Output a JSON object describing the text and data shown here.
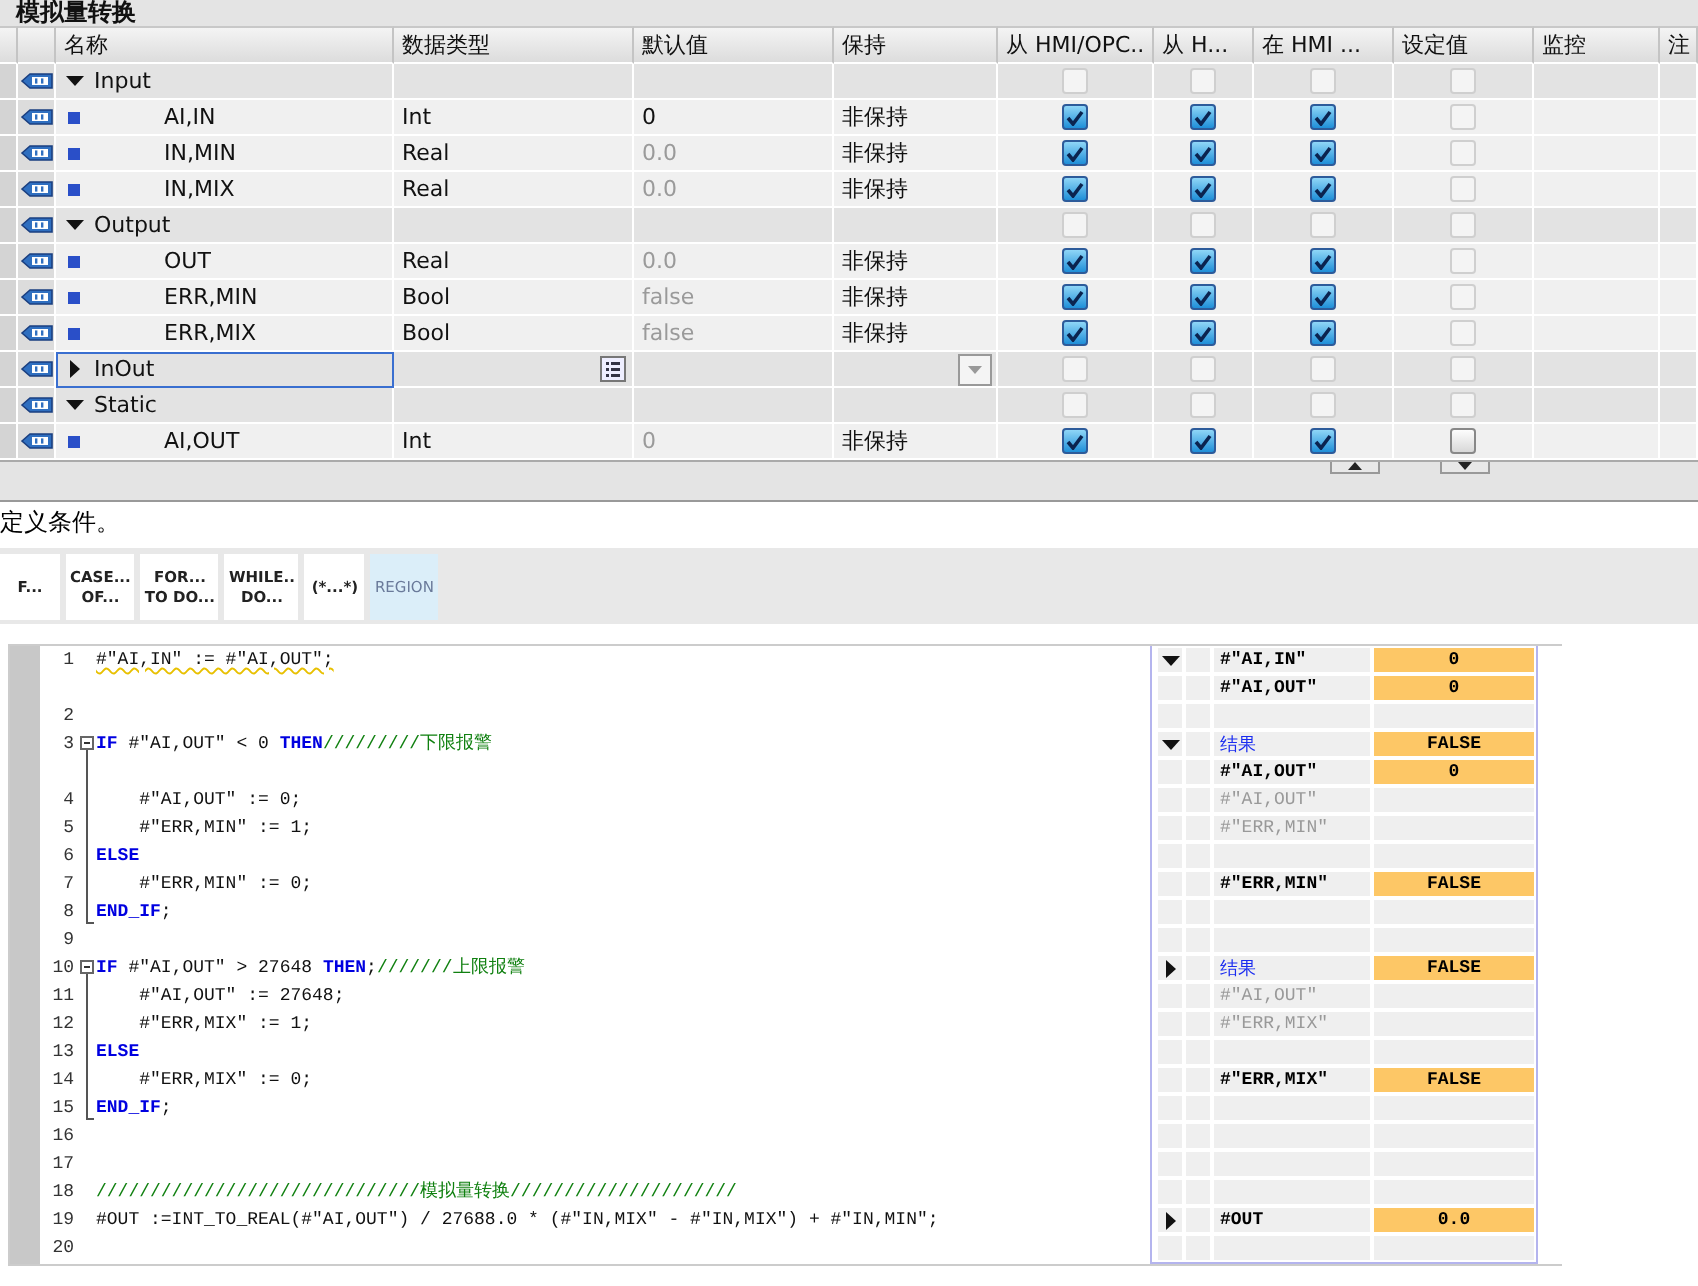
{
  "block_title": "模拟量转换",
  "table": {
    "columns": [
      "名称",
      "数据类型",
      "默认值",
      "保持",
      "从 HMI/OPC..",
      "从 H...",
      "在 HMI ...",
      "设定值",
      "监控",
      "注"
    ],
    "rows": [
      {
        "kind": "section",
        "name": "Input",
        "expanded": true,
        "selected": false,
        "checkboxes": [
          {
            "checked": false,
            "disabled": true
          },
          {
            "checked": false,
            "disabled": true
          },
          {
            "checked": false,
            "disabled": true
          },
          {
            "checked": false,
            "disabled": true
          }
        ]
      },
      {
        "kind": "var",
        "name": "AI,IN",
        "type": "Int",
        "default": "0",
        "default_dim": false,
        "retain": "非保持",
        "selected": false,
        "checkboxes": [
          {
            "checked": true,
            "disabled": false
          },
          {
            "checked": true,
            "disabled": false
          },
          {
            "checked": true,
            "disabled": false
          },
          {
            "checked": false,
            "disabled": true
          }
        ]
      },
      {
        "kind": "var",
        "name": "IN,MIN",
        "type": "Real",
        "default": "0.0",
        "default_dim": true,
        "retain": "非保持",
        "selected": false,
        "checkboxes": [
          {
            "checked": true,
            "disabled": false
          },
          {
            "checked": true,
            "disabled": false
          },
          {
            "checked": true,
            "disabled": false
          },
          {
            "checked": false,
            "disabled": true
          }
        ]
      },
      {
        "kind": "var",
        "name": "IN,MIX",
        "type": "Real",
        "default": "0.0",
        "default_dim": true,
        "retain": "非保持",
        "selected": false,
        "checkboxes": [
          {
            "checked": true,
            "disabled": false
          },
          {
            "checked": true,
            "disabled": false
          },
          {
            "checked": true,
            "disabled": false
          },
          {
            "checked": false,
            "disabled": true
          }
        ]
      },
      {
        "kind": "section",
        "name": "Output",
        "expanded": true,
        "selected": false,
        "checkboxes": [
          {
            "checked": false,
            "disabled": true
          },
          {
            "checked": false,
            "disabled": true
          },
          {
            "checked": false,
            "disabled": true
          },
          {
            "checked": false,
            "disabled": true
          }
        ]
      },
      {
        "kind": "var",
        "name": "OUT",
        "type": "Real",
        "default": "0.0",
        "default_dim": true,
        "retain": "非保持",
        "selected": false,
        "checkboxes": [
          {
            "checked": true,
            "disabled": false
          },
          {
            "checked": true,
            "disabled": false
          },
          {
            "checked": true,
            "disabled": false
          },
          {
            "checked": false,
            "disabled": true
          }
        ]
      },
      {
        "kind": "var",
        "name": "ERR,MIN",
        "type": "Bool",
        "default": "false",
        "default_dim": true,
        "retain": "非保持",
        "selected": false,
        "checkboxes": [
          {
            "checked": true,
            "disabled": false
          },
          {
            "checked": true,
            "disabled": false
          },
          {
            "checked": true,
            "disabled": false
          },
          {
            "checked": false,
            "disabled": true
          }
        ]
      },
      {
        "kind": "var",
        "name": "ERR,MIX",
        "type": "Bool",
        "default": "false",
        "default_dim": true,
        "retain": "非保持",
        "selected": false,
        "checkboxes": [
          {
            "checked": true,
            "disabled": false
          },
          {
            "checked": true,
            "disabled": false
          },
          {
            "checked": true,
            "disabled": false
          },
          {
            "checked": false,
            "disabled": true
          }
        ]
      },
      {
        "kind": "section",
        "name": "InOut",
        "expanded": false,
        "selected": true,
        "checkboxes": [
          {
            "checked": false,
            "disabled": true
          },
          {
            "checked": false,
            "disabled": true
          },
          {
            "checked": false,
            "disabled": true
          },
          {
            "checked": false,
            "disabled": true
          }
        ]
      },
      {
        "kind": "section",
        "name": "Static",
        "expanded": true,
        "selected": false,
        "checkboxes": [
          {
            "checked": false,
            "disabled": true
          },
          {
            "checked": false,
            "disabled": true
          },
          {
            "checked": false,
            "disabled": true
          },
          {
            "checked": false,
            "disabled": true
          }
        ]
      },
      {
        "kind": "var",
        "name": "AI,OUT",
        "type": "Int",
        "default": "0",
        "default_dim": true,
        "retain": "非保持",
        "selected": false,
        "checkboxes": [
          {
            "checked": true,
            "disabled": false
          },
          {
            "checked": true,
            "disabled": false
          },
          {
            "checked": true,
            "disabled": false
          },
          {
            "checked": false,
            "disabled": false
          }
        ]
      }
    ]
  },
  "description": "定义条件。",
  "toolbar": [
    {
      "label": "F...",
      "selected": false
    },
    {
      "label": "CASE...\nOF...",
      "selected": false
    },
    {
      "label": "FOR...\nTO DO...",
      "selected": false
    },
    {
      "label": "WHILE..\nDO...",
      "selected": false
    },
    {
      "label": "(*...*)",
      "selected": false
    },
    {
      "label": "REGION",
      "selected": true
    }
  ],
  "code": [
    {
      "number": "1",
      "warning": true,
      "segments": [
        {
          "kind": "plain",
          "text": "#\"AI,IN\" := #\"AI,OUT\";"
        }
      ],
      "monitor": [
        {
          "kind": "var",
          "expandable": true,
          "expanded": true,
          "expr": "#\"AI,IN\"",
          "value": "0",
          "active": true
        },
        {
          "kind": "var",
          "expr": "#\"AI,OUT\"",
          "value": "0",
          "active": true
        }
      ]
    },
    {
      "number": "2"
    },
    {
      "number": "3",
      "collapsible": true,
      "expanded": true,
      "segments": [
        {
          "kind": "keyword",
          "text": "IF"
        },
        {
          "kind": "plain",
          "text": " #\"AI,OUT\" < 0 "
        },
        {
          "kind": "keyword",
          "text": "THEN"
        },
        {
          "kind": "comment",
          "text": "/////////下限报警"
        }
      ],
      "monitor": [
        {
          "kind": "result",
          "expandable": true,
          "expanded": true,
          "expr": "结果",
          "value": "FALSE",
          "active": true
        },
        {
          "kind": "var",
          "expr": "#\"AI,OUT\"",
          "value": "0",
          "active": true
        }
      ]
    },
    {
      "number": "4",
      "in_block": true,
      "segments": [
        {
          "kind": "plain",
          "text": "    #\"AI,OUT\" := 0;"
        }
      ],
      "monitor": [
        {
          "kind": "var",
          "expr": "#\"AI,OUT\"",
          "active": false
        }
      ]
    },
    {
      "number": "5",
      "in_block": true,
      "segments": [
        {
          "kind": "plain",
          "text": "    #\"ERR,MIN\" := 1;"
        }
      ],
      "monitor": [
        {
          "kind": "var",
          "expr": "#\"ERR,MIN\"",
          "active": false
        }
      ]
    },
    {
      "number": "6",
      "in_block": true,
      "segments": [
        {
          "kind": "keyword",
          "text": "ELSE"
        }
      ]
    },
    {
      "number": "7",
      "in_block": true,
      "segments": [
        {
          "kind": "plain",
          "text": "    #\"ERR,MIN\" := 0;"
        }
      ],
      "monitor": [
        {
          "kind": "var",
          "expr": "#\"ERR,MIN\"",
          "value": "FALSE",
          "active": true
        }
      ]
    },
    {
      "number": "8",
      "block_end": true,
      "segments": [
        {
          "kind": "keyword",
          "text": "END_IF"
        },
        {
          "kind": "plain",
          "text": ";"
        }
      ]
    },
    {
      "number": "9"
    },
    {
      "number": "10",
      "collapsible": true,
      "expanded": true,
      "segments": [
        {
          "kind": "keyword",
          "text": "IF"
        },
        {
          "kind": "plain",
          "text": " #\"AI,OUT\" > 27648 "
        },
        {
          "kind": "keyword",
          "text": "THEN"
        },
        {
          "kind": "plain",
          "text": ";"
        },
        {
          "kind": "comment",
          "text": "///////上限报警"
        }
      ],
      "monitor": [
        {
          "kind": "result",
          "expandable": true,
          "expanded": false,
          "expr": "结果",
          "value": "FALSE",
          "active": true
        }
      ]
    },
    {
      "number": "11",
      "in_block": true,
      "segments": [
        {
          "kind": "plain",
          "text": "    #\"AI,OUT\" := 27648;"
        }
      ],
      "monitor": [
        {
          "kind": "var",
          "expr": "#\"AI,OUT\"",
          "active": false
        }
      ]
    },
    {
      "number": "12",
      "in_block": true,
      "segments": [
        {
          "kind": "plain",
          "text": "    #\"ERR,MIX\" := 1;"
        }
      ],
      "monitor": [
        {
          "kind": "var",
          "expr": "#\"ERR,MIX\"",
          "active": false
        }
      ]
    },
    {
      "number": "13",
      "in_block": true,
      "segments": [
        {
          "kind": "keyword",
          "text": "ELSE"
        }
      ]
    },
    {
      "number": "14",
      "in_block": true,
      "segments": [
        {
          "kind": "plain",
          "text": "    #\"ERR,MIX\" := 0;"
        }
      ],
      "monitor": [
        {
          "kind": "var",
          "expr": "#\"ERR,MIX\"",
          "value": "FALSE",
          "active": true
        }
      ]
    },
    {
      "number": "15",
      "block_end": true,
      "segments": [
        {
          "kind": "keyword",
          "text": "END_IF"
        },
        {
          "kind": "plain",
          "text": ";"
        }
      ]
    },
    {
      "number": "16"
    },
    {
      "number": "17"
    },
    {
      "number": "18",
      "segments": [
        {
          "kind": "comment",
          "text": "//////////////////////////////模拟量转换/////////////////////"
        }
      ]
    },
    {
      "number": "19",
      "segments": [
        {
          "kind": "plain",
          "text": "#OUT :=INT_TO_REAL(#\"AI,OUT\") / 27688.0 * (#\"IN,MIX\" - #\"IN,MIX\") + #\"IN,MIN\";"
        }
      ],
      "monitor": [
        {
          "kind": "var",
          "expandable": true,
          "expanded": false,
          "expr": "#OUT",
          "value": "0.0",
          "active": true
        }
      ]
    },
    {
      "number": "20"
    }
  ]
}
